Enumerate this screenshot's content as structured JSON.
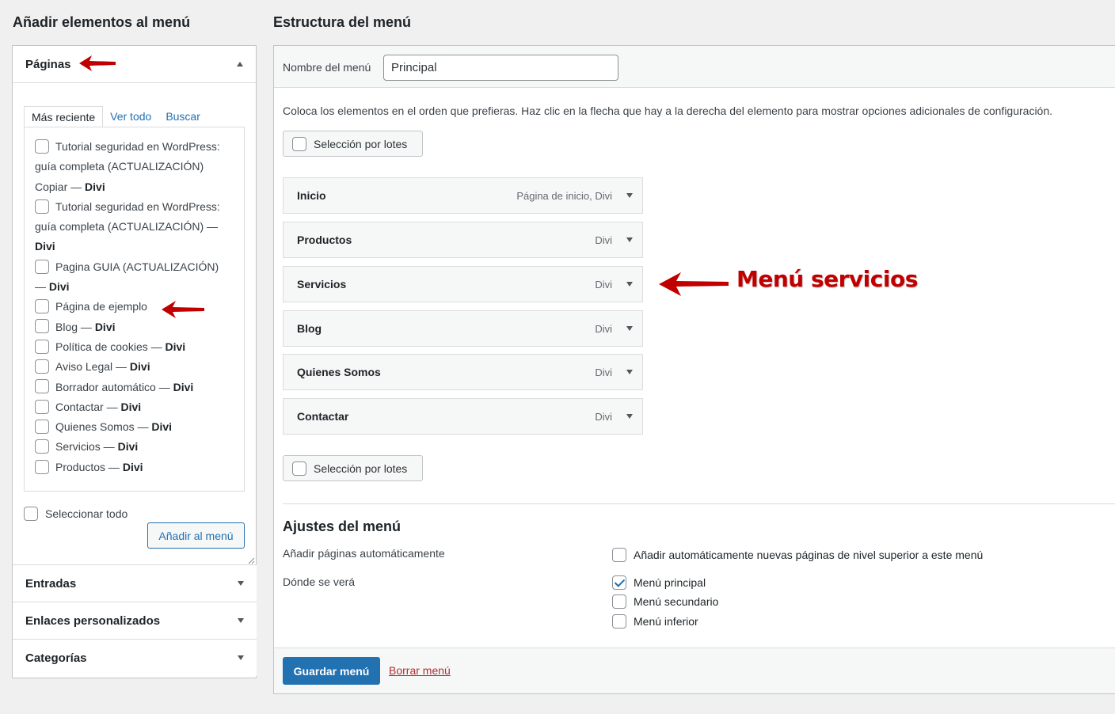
{
  "left": {
    "title": "Añadir elementos al menú",
    "pages_section": {
      "title": "Páginas",
      "tabs": [
        "Más reciente",
        "Ver todo",
        "Buscar"
      ],
      "items": [
        {
          "line1": "Tutorial seguridad en WordPress:",
          "line2": "guía completa (ACTUALIZACIÓN)",
          "line3_plain": "Copiar — ",
          "line3_bold": "Divi"
        },
        {
          "line1": "Tutorial seguridad en WordPress:",
          "line2": "guía completa (ACTUALIZACIÓN) —",
          "line3_bold": "Divi"
        },
        {
          "line1": "Pagina GUIA (ACTUALIZACIÓN)",
          "line2_plain": "— ",
          "line2_bold": "Divi"
        },
        {
          "label": "Página de ejemplo",
          "suffix": ""
        },
        {
          "label": "Blog — ",
          "suffix": "Divi"
        },
        {
          "label": "Política de cookies — ",
          "suffix": "Divi"
        },
        {
          "label": "Aviso Legal — ",
          "suffix": "Divi"
        },
        {
          "label": "Borrador automático — ",
          "suffix": "Divi"
        },
        {
          "label": "Contactar — ",
          "suffix": "Divi"
        },
        {
          "label": "Quienes Somos — ",
          "suffix": "Divi"
        },
        {
          "label": "Servicios — ",
          "suffix": "Divi"
        },
        {
          "label": "Productos — ",
          "suffix": "Divi"
        }
      ],
      "select_all": "Seleccionar todo",
      "add_button": "Añadir al menú"
    },
    "other_sections": [
      "Entradas",
      "Enlaces personalizados",
      "Categorías"
    ]
  },
  "right": {
    "title": "Estructura del menú",
    "name_label": "Nombre del menú",
    "name_value": "Principal",
    "instructions": "Coloca los elementos en el orden que prefieras. Haz clic en la flecha que hay a la derecha del elemento para mostrar opciones adicionales de configuración.",
    "bulk_select": "Selección por lotes",
    "menu_items": [
      {
        "title": "Inicio",
        "type": "Página de inicio, Divi"
      },
      {
        "title": "Productos",
        "type": "Divi"
      },
      {
        "title": "Servicios",
        "type": "Divi"
      },
      {
        "title": "Blog",
        "type": "Divi"
      },
      {
        "title": "Quienes Somos",
        "type": "Divi"
      },
      {
        "title": "Contactar",
        "type": "Divi"
      }
    ],
    "annotation": "Menú servicios",
    "settings": {
      "title": "Ajustes del menú",
      "auto_add_label": "Añadir páginas automáticamente",
      "auto_add_option": "Añadir automáticamente nuevas páginas de nivel superior a este menú",
      "location_label": "Dónde se verá",
      "locations": [
        {
          "label": "Menú principal",
          "checked": true
        },
        {
          "label": "Menú secundario",
          "checked": false
        },
        {
          "label": "Menú inferior",
          "checked": false
        }
      ]
    },
    "save_button": "Guardar menú",
    "delete_link": "Borrar menú"
  },
  "colors": {
    "accent": "#2271b1",
    "annotation_red": "#c00000",
    "background": "#f0f0f1"
  }
}
